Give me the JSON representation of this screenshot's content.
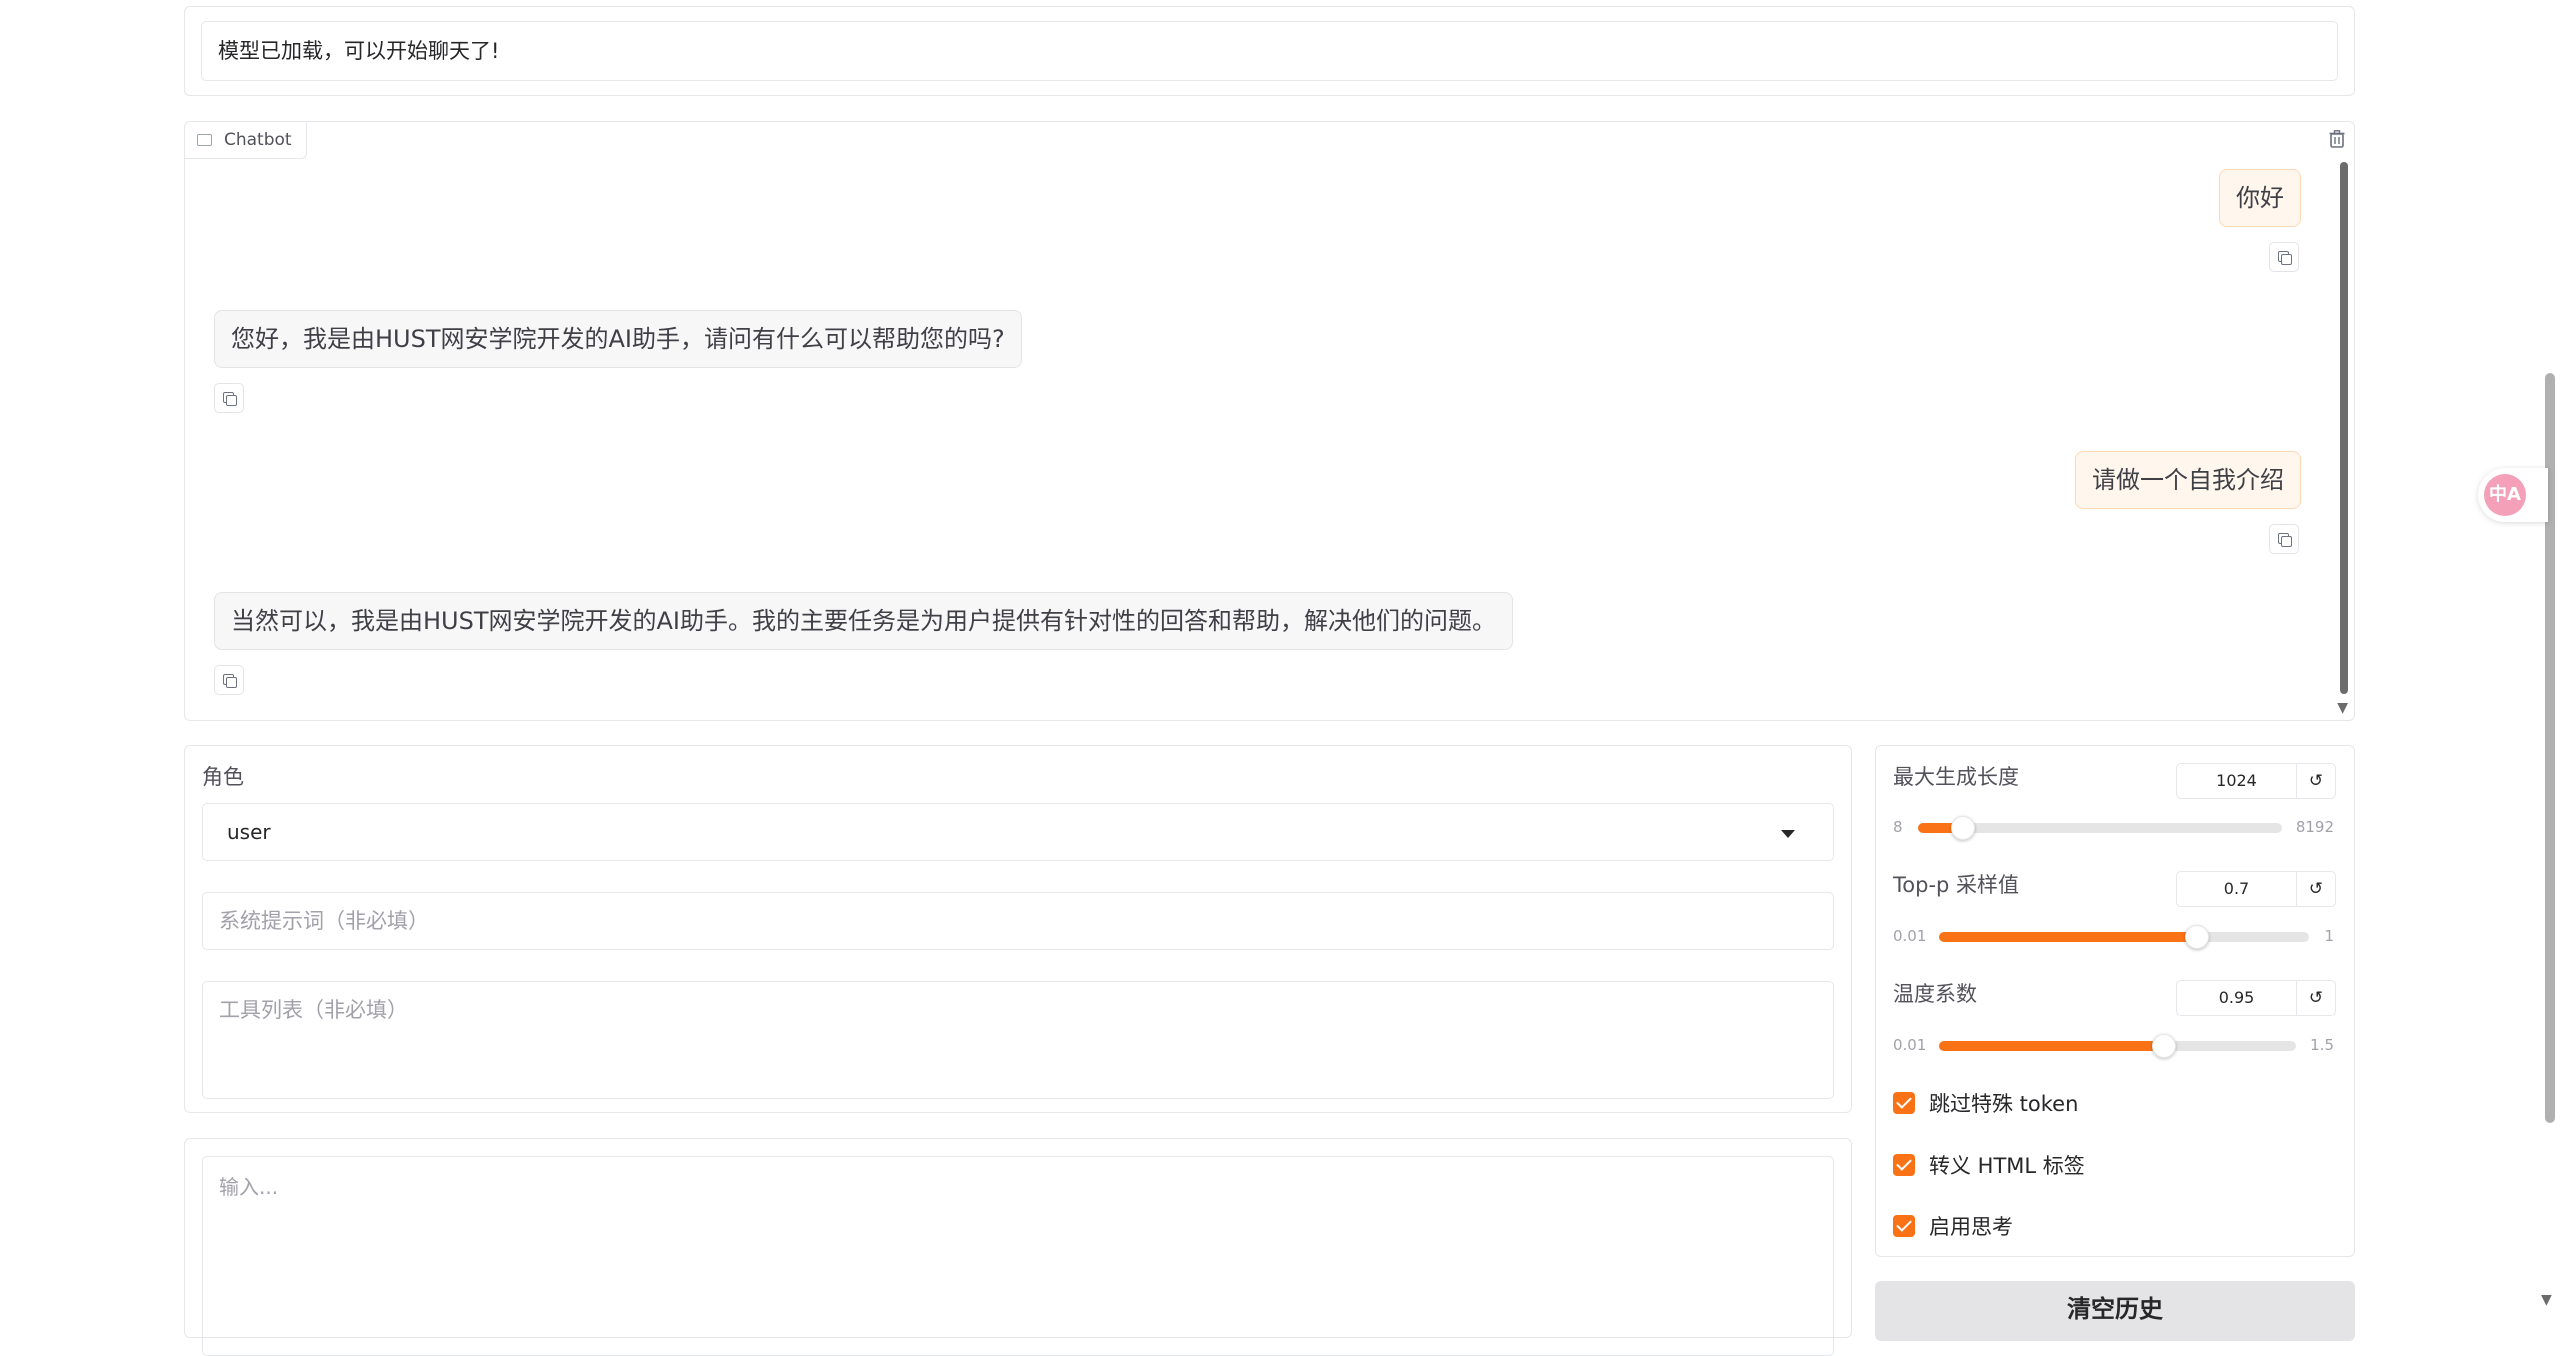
{
  "status": {
    "text": "模型已加载，可以开始聊天了!"
  },
  "chatbot": {
    "label": "Chatbot",
    "messages": [
      {
        "role": "user",
        "text": "你好"
      },
      {
        "role": "bot",
        "text": "您好，我是由HUST网安学院开发的AI助手，请问有什么可以帮助您的吗?"
      },
      {
        "role": "user",
        "text": "请做一个自我介绍"
      },
      {
        "role": "bot",
        "text": "当然可以，我是由HUST网安学院开发的AI助手。我的主要任务是为用户提供有针对性的回答和帮助，解决他们的问题。"
      }
    ]
  },
  "role": {
    "label": "角色",
    "value": "user"
  },
  "system_prompt": {
    "placeholder": "系统提示词（非必填）"
  },
  "tools": {
    "placeholder": "工具列表（非必填）"
  },
  "input": {
    "placeholder": "输入..."
  },
  "params": {
    "max_length": {
      "label": "最大生成长度",
      "value": "1024",
      "min": "8",
      "max": "8192",
      "fraction": 0.124
    },
    "top_p": {
      "label": "Top-p 采样值",
      "value": "0.7",
      "min": "0.01",
      "max": "1",
      "fraction": 0.697
    },
    "temperature": {
      "label": "温度系数",
      "value": "0.95",
      "min": "0.01",
      "max": "1.5",
      "fraction": 0.631
    }
  },
  "checkboxes": [
    {
      "label": "跳过特殊 token",
      "checked": true
    },
    {
      "label": "转义 HTML 标签",
      "checked": true
    },
    {
      "label": "启用思考",
      "checked": true
    }
  ],
  "clear_button": {
    "label": "清空历史"
  },
  "colors": {
    "accent": "#f97316",
    "user_bubble": "#fff7ed",
    "bot_bubble": "#f7f7f8"
  },
  "icons": {
    "reset": "↺",
    "trash": "trash-icon",
    "copy": "copy-icon",
    "translate": "中A"
  }
}
